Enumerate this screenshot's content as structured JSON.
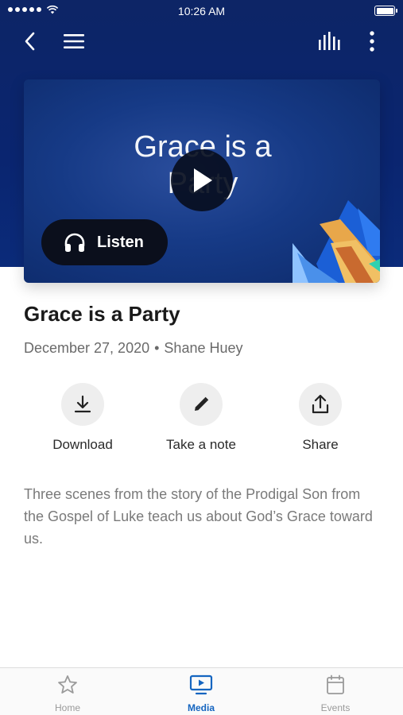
{
  "status_bar": {
    "time": "10:26 AM"
  },
  "artwork": {
    "title": "Grace is a Party",
    "listen_label": "Listen"
  },
  "sermon": {
    "title": "Grace is a Party",
    "date": "December 27, 2020",
    "separator": "•",
    "speaker": "Shane Huey",
    "description": "Three scenes from the story of the Prodigal Son from the Gospel of Luke teach us about God’s Grace toward us."
  },
  "actions": [
    {
      "label": "Download",
      "icon": "download-icon"
    },
    {
      "label": "Take a note",
      "icon": "pencil-icon"
    },
    {
      "label": "Share",
      "icon": "share-icon"
    }
  ],
  "tabs": [
    {
      "label": "Home",
      "icon": "star-icon",
      "active": false
    },
    {
      "label": "Media",
      "icon": "media-icon",
      "active": true
    },
    {
      "label": "Events",
      "icon": "calendar-icon",
      "active": false
    }
  ],
  "colors": {
    "hero": "#0a2570",
    "accent": "#1565c0"
  }
}
